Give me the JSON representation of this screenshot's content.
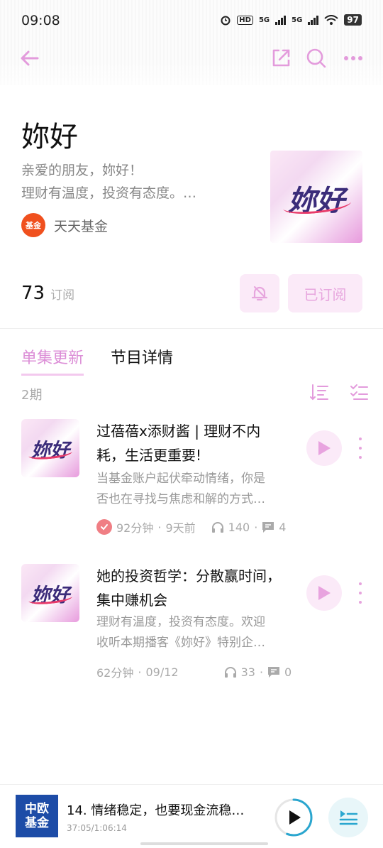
{
  "status_bar": {
    "time": "09:08",
    "network1": "5G",
    "network2": "5G",
    "hd": "HD",
    "battery": "97"
  },
  "toolbar": {
    "back_icon": "arrow-left-icon",
    "share_icon": "share-icon",
    "search_icon": "search-icon",
    "more_icon": "more-icon"
  },
  "podcast": {
    "title": "妳好",
    "desc_line1": "亲爱的朋友，妳好！",
    "desc_line2": "理财有温度，投资有态度。…",
    "author": "天天基金",
    "author_logo_text": "基金",
    "cover_text": "妳好",
    "subscriber_count": "73",
    "subscriber_label": "订阅",
    "subscribed_label": "已订阅"
  },
  "tabs": [
    {
      "label": "单集更新",
      "active": true
    },
    {
      "label": "节目详情",
      "active": false
    }
  ],
  "episode_count": "2期",
  "episodes": [
    {
      "title": "过蓓蓓x添财酱 | 理财不内耗，生活更重要!",
      "desc_line1": "当基金账户起伏牵动情绪，你是",
      "desc_line2": "否也在寻找与焦虑和解的方式…",
      "duration": "92分钟",
      "date": "9天前",
      "plays": "140",
      "comments": "4",
      "played": true,
      "cover_text": "妳好"
    },
    {
      "title": "她的投资哲学：分散赢时间，集中赚机会",
      "desc_line1": "理财有温度，投资有态度。欢迎",
      "desc_line2": "收听本期播客《妳好》特别企…",
      "duration": "62分钟",
      "date": "09/12",
      "plays": "33",
      "comments": "0",
      "played": false,
      "cover_text": "妳好"
    }
  ],
  "mini_player": {
    "cover_line1": "中欧",
    "cover_line2": "基金",
    "title": "14. 情绪稳定，也要现金流稳…",
    "progress_text": "37:05/1:06:14",
    "progress": 0.56
  },
  "colors": {
    "accent": "#dc8fd7",
    "accent_light": "#fbeaf8",
    "player_accent": "#2aa6cf"
  }
}
